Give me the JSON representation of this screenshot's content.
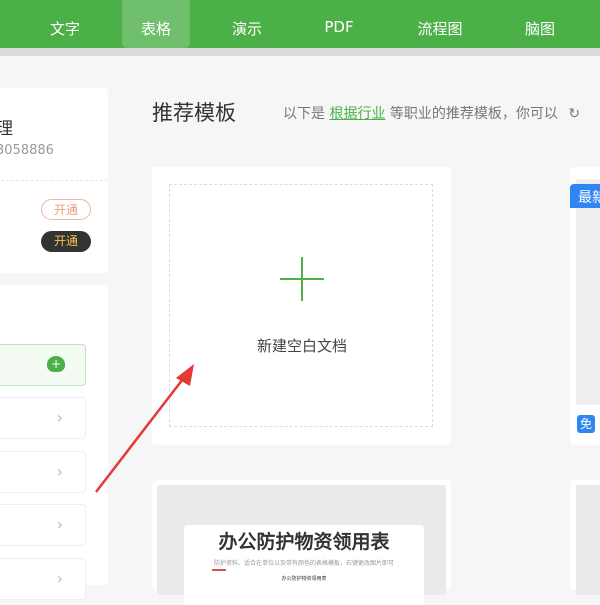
{
  "tabs": [
    {
      "label": "文字"
    },
    {
      "label": "表格"
    },
    {
      "label": "演示"
    },
    {
      "label": "PDF"
    },
    {
      "label": "流程图"
    },
    {
      "label": "脑图"
    }
  ],
  "user": {
    "name_fragment": "理",
    "id_fragment": "3058886",
    "open_label_1": "开通",
    "open_label_2": "开通"
  },
  "main": {
    "title": "推荐模板",
    "subtitle_prefix": "以下是",
    "subtitle_link": "根据行业",
    "subtitle_suffix": "等职业的推荐模板，你可以",
    "new_blank": "新建空白文档",
    "tag_new": "最新",
    "tag_free": "免",
    "template_title": "办公防护物资领用表",
    "template_desc": "防护资料、适合在单位以及带有颜色的表格模板，右键更改图片即可",
    "template_sub": "办公防护物资领用表"
  },
  "colors": {
    "green": "#4cb048",
    "blue": "#2f86f0",
    "arrow": "#e53935"
  }
}
